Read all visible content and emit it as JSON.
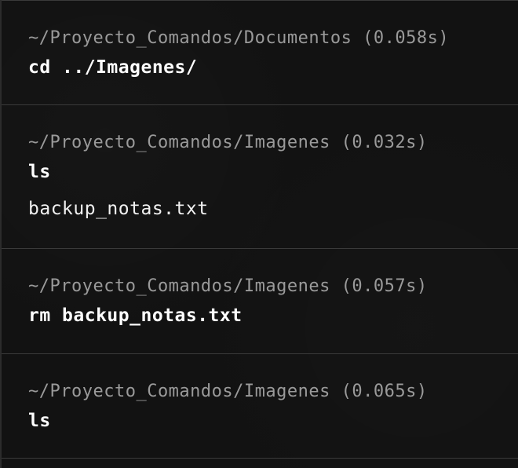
{
  "blocks": [
    {
      "path": "~/Proyecto_Comandos/Documentos",
      "duration": "(0.058s)",
      "command": "cd ../Imagenes/"
    },
    {
      "path": "~/Proyecto_Comandos/Imagenes",
      "duration": "(0.032s)",
      "command": "ls",
      "output": "backup_notas.txt"
    },
    {
      "path": "~/Proyecto_Comandos/Imagenes",
      "duration": "(0.057s)",
      "command": "rm backup_notas.txt"
    },
    {
      "path": "~/Proyecto_Comandos/Imagenes",
      "duration": "(0.065s)",
      "command": "ls"
    }
  ]
}
